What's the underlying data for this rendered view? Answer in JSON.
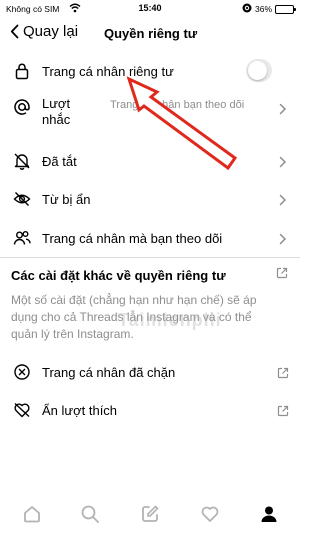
{
  "status_bar": {
    "carrier": "Không có SIM",
    "time": "15:40",
    "battery": "36%",
    "battery_level": 0.36
  },
  "header": {
    "back_label": "Quay lại",
    "title": "Quyền riêng tư"
  },
  "items": {
    "private_profile": {
      "label": "Trang cá nhân riêng tư",
      "toggle_on": false
    },
    "mentions": {
      "label_line1": "Lượt",
      "label_line2": "nhắc",
      "value": "Trang cá nhân bạn theo dõi"
    },
    "muted": {
      "label": "Đã tắt"
    },
    "hidden_words": {
      "label": "Từ bị ẩn"
    },
    "following_profiles": {
      "label": "Trang cá nhân mà bạn theo dõi"
    }
  },
  "other_settings": {
    "title": "Các cài đặt khác về quyền riêng tư",
    "description": "Một số cài đặt (chẳng hạn như hạn chế) sẽ áp dụng cho cả Threads lẫn Instagram và có thể quản lý trên Instagram.",
    "blocked_profiles": {
      "label": "Trang cá nhân đã chặn"
    },
    "hide_likes": {
      "label": "Ẩn lượt thích"
    }
  },
  "watermark": "Taimienphi",
  "colors": {
    "arrow": "#e0281c",
    "secondary_text": "#8e8e8e",
    "divider": "#dbdbdb",
    "toggle_off": "#e9e9eb"
  }
}
